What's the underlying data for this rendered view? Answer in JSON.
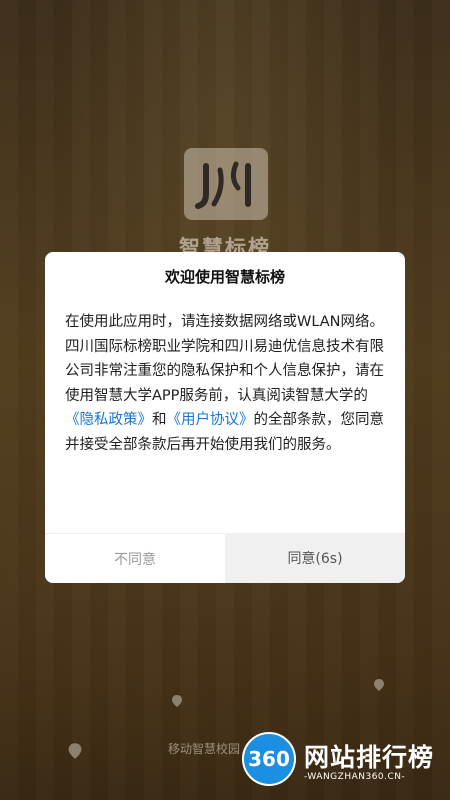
{
  "background": {
    "app_title": "智慧标榜",
    "bottom_caption": "移动智慧校园"
  },
  "dialog": {
    "title": "欢迎使用智慧标榜",
    "body_text_1": "在使用此应用时，请连接数据网络或WLAN网络。四川国际标榜职业学院和四川易迪优信息技术有限公司非常注重您的隐私保护和个人信息保护，请在使用智慧大学APP服务前，认真阅读智慧大学的",
    "privacy_link": "《隐私政策》",
    "body_and": "和",
    "agreement_link": "《用户协议》",
    "body_text_2": "的全部条款，您同意并接受全部条款后再开始使用我们的服务。",
    "disagree_label": "不同意",
    "agree_label": "同意(6s)"
  },
  "watermark": {
    "badge": "360",
    "title": "网站排行榜",
    "subtitle": "-WANGZHAN360.CN-"
  },
  "colors": {
    "link": "#1976d2",
    "watermark_blue": "#1d8fe0"
  }
}
